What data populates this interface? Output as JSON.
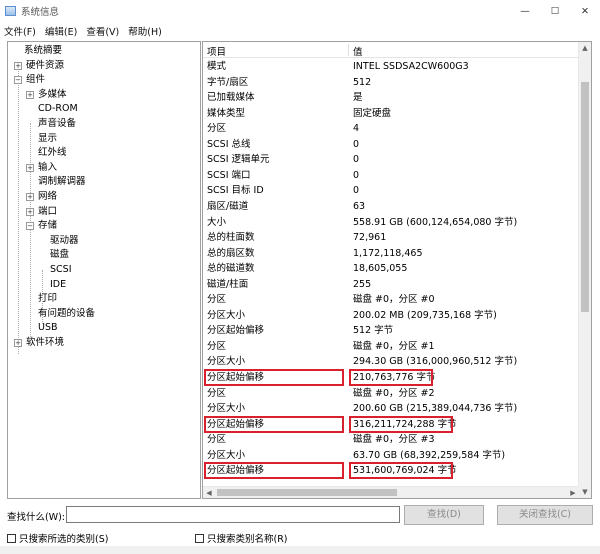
{
  "window": {
    "title": "系统信息",
    "controls": {
      "minimize": "—",
      "maximize": "☐",
      "close": "✕"
    }
  },
  "menu": [
    {
      "label": "文件(F)"
    },
    {
      "label": "编辑(E)"
    },
    {
      "label": "查看(V)"
    },
    {
      "label": "帮助(H)"
    }
  ],
  "tree": [
    {
      "label": "系统摘要",
      "indent": 0,
      "expander": ""
    },
    {
      "label": "硬件资源",
      "indent": 1,
      "expander": "+"
    },
    {
      "label": "组件",
      "indent": 1,
      "expander": "−"
    },
    {
      "label": "多媒体",
      "indent": 2,
      "expander": "+"
    },
    {
      "label": "CD-ROM",
      "indent": 2,
      "expander": ""
    },
    {
      "label": "声音设备",
      "indent": 2,
      "expander": ""
    },
    {
      "label": "显示",
      "indent": 2,
      "expander": ""
    },
    {
      "label": "红外线",
      "indent": 2,
      "expander": ""
    },
    {
      "label": "输入",
      "indent": 2,
      "expander": "+"
    },
    {
      "label": "调制解调器",
      "indent": 2,
      "expander": ""
    },
    {
      "label": "网络",
      "indent": 2,
      "expander": "+"
    },
    {
      "label": "端口",
      "indent": 2,
      "expander": "+"
    },
    {
      "label": "存储",
      "indent": 2,
      "expander": "−"
    },
    {
      "label": "驱动器",
      "indent": 3,
      "expander": ""
    },
    {
      "label": "磁盘",
      "indent": 3,
      "expander": ""
    },
    {
      "label": "SCSI",
      "indent": 3,
      "expander": ""
    },
    {
      "label": "IDE",
      "indent": 3,
      "expander": ""
    },
    {
      "label": "打印",
      "indent": 2,
      "expander": ""
    },
    {
      "label": "有问题的设备",
      "indent": 2,
      "expander": ""
    },
    {
      "label": "USB",
      "indent": 2,
      "expander": ""
    },
    {
      "label": "软件环境",
      "indent": 1,
      "expander": "+"
    }
  ],
  "table": {
    "headers": {
      "item": "项目",
      "value": "值"
    },
    "rows": [
      {
        "item": "模式",
        "value": "INTEL SSDSA2CW600G3"
      },
      {
        "item": "字节/扇区",
        "value": "512"
      },
      {
        "item": "已加载媒体",
        "value": "是"
      },
      {
        "item": "媒体类型",
        "value": "固定硬盘"
      },
      {
        "item": "分区",
        "value": "4"
      },
      {
        "item": "SCSI 总线",
        "value": "0"
      },
      {
        "item": "SCSI 逻辑单元",
        "value": "0"
      },
      {
        "item": "SCSI 端口",
        "value": "0"
      },
      {
        "item": "SCSI 目标 ID",
        "value": "0"
      },
      {
        "item": "扇区/磁道",
        "value": "63"
      },
      {
        "item": "大小",
        "value": "558.91 GB (600,124,654,080 字节)"
      },
      {
        "item": "总的柱面数",
        "value": "72,961"
      },
      {
        "item": "总的扇区数",
        "value": "1,172,118,465"
      },
      {
        "item": "总的磁道数",
        "value": "18,605,055"
      },
      {
        "item": "磁道/柱面",
        "value": "255"
      },
      {
        "item": "分区",
        "value": "磁盘 #0，分区 #0"
      },
      {
        "item": "分区大小",
        "value": "200.02 MB (209,735,168 字节)"
      },
      {
        "item": "分区起始偏移",
        "value": "512 字节"
      },
      {
        "item": "分区",
        "value": "磁盘 #0，分区 #1"
      },
      {
        "item": "分区大小",
        "value": "294.30 GB (316,000,960,512 字节)"
      },
      {
        "item": "分区起始偏移",
        "value": "210,763,776 字节",
        "highlight": true
      },
      {
        "item": "分区",
        "value": "磁盘 #0，分区 #2"
      },
      {
        "item": "分区大小",
        "value": "200.60 GB (215,389,044,736 字节)"
      },
      {
        "item": "分区起始偏移",
        "value": "316,211,724,288 字节",
        "highlight": true
      },
      {
        "item": "分区",
        "value": "磁盘 #0，分区 #3"
      },
      {
        "item": "分区大小",
        "value": "63.70 GB (68,392,259,584 字节)"
      },
      {
        "item": "分区起始偏移",
        "value": "531,600,769,024 字节",
        "highlight": true
      }
    ]
  },
  "find": {
    "label": "查找什么(W):",
    "value": "",
    "find_button": "查找(D)",
    "close_button": "关闭查找(C)"
  },
  "options": {
    "search_selected": "只搜索所选的类别(S)",
    "search_names": "只搜索类别名称(R)"
  },
  "colors": {
    "highlight_border": "#d8212f"
  }
}
